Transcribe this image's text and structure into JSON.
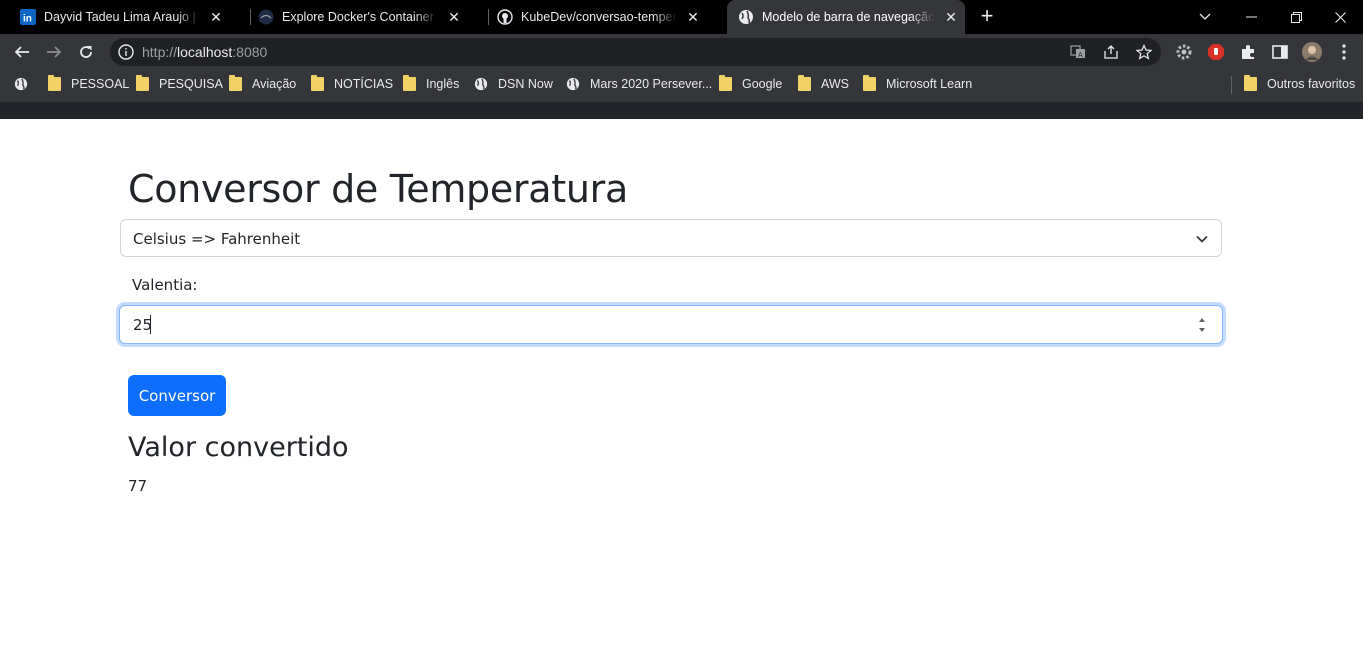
{
  "browser": {
    "tabs": [
      {
        "title": "Dayvid Tadeu Lima Araujo | LinkedIn",
        "favicon": "linkedin-icon",
        "active": false
      },
      {
        "title": "Explore Docker's Container Image Repository",
        "favicon": "docker-icon",
        "active": false
      },
      {
        "title": "KubeDev/conversao-temperatura",
        "favicon": "github-icon",
        "active": false
      },
      {
        "title": "Modelo de barra de navegação do Bootstrap",
        "favicon": "globe-icon",
        "active": true
      }
    ],
    "url_prefix": "http://",
    "url_host": "localhost",
    "url_port": ":8080",
    "bookmarks": [
      {
        "label": "PESSOAL",
        "icon": "folder-icon"
      },
      {
        "label": "PESQUISA",
        "icon": "folder-icon"
      },
      {
        "label": "Aviação",
        "icon": "folder-icon"
      },
      {
        "label": "NOTÍCIAS",
        "icon": "folder-icon"
      },
      {
        "label": "Inglês",
        "icon": "folder-icon"
      },
      {
        "label": "DSN Now",
        "icon": "globe-icon"
      },
      {
        "label": "Mars 2020 Persever...",
        "icon": "globe-icon"
      },
      {
        "label": "Google",
        "icon": "folder-icon"
      },
      {
        "label": "AWS",
        "icon": "folder-icon"
      },
      {
        "label": "Microsoft Learn",
        "icon": "folder-icon"
      }
    ],
    "other_bookmarks": "Outros favoritos"
  },
  "page": {
    "title": "Conversor de Temperatura",
    "select": {
      "value": "Celsius => Fahrenheit"
    },
    "value_label": "Valentia:",
    "input": {
      "value": "25"
    },
    "button_label": "Conversor",
    "result_title": "Valor convertido",
    "result_value": "77"
  },
  "colors": {
    "primary": "#0d6efd",
    "navbar": "#212529",
    "chrome_toolbar": "#35363a",
    "chrome_tabstrip": "#000000"
  }
}
